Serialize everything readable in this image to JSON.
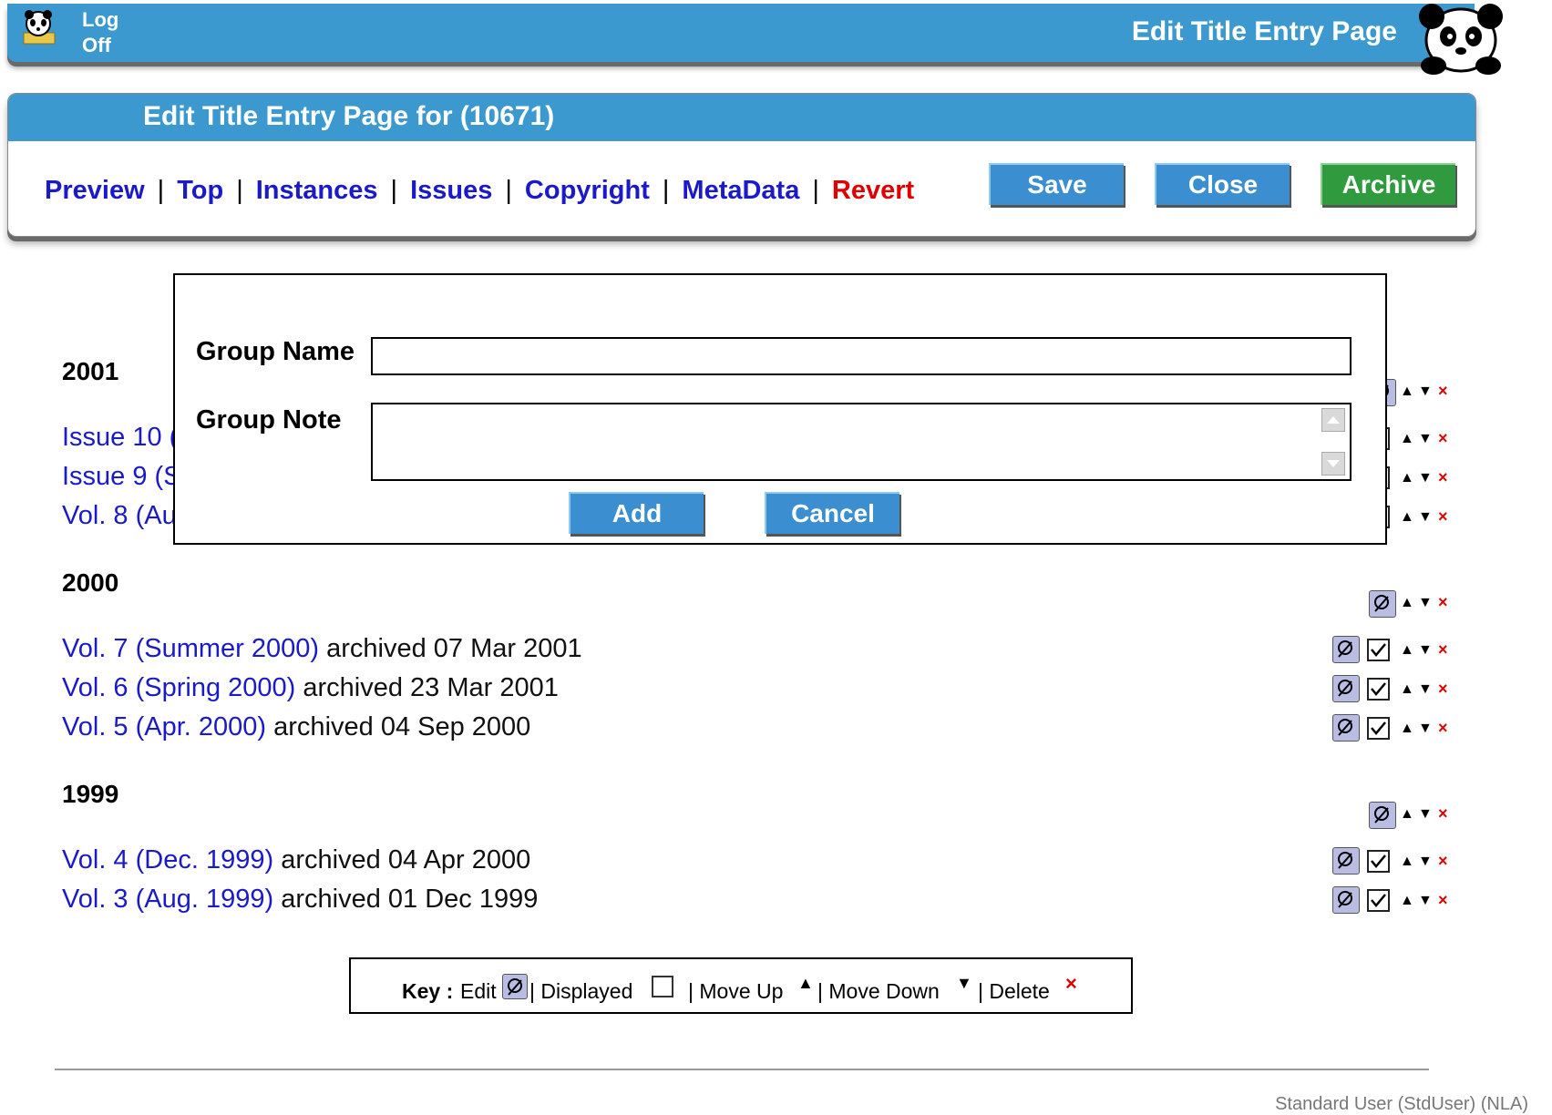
{
  "header": {
    "logoff_label_line1": "Log",
    "logoff_label_line2": "Off",
    "page_title": "Edit Title Entry Page"
  },
  "panel": {
    "title": "Edit Title Entry Page for (10671)",
    "nav": [
      "Preview",
      "Top",
      "Instances",
      "Issues",
      "Copyright",
      "MetaData",
      "Revert"
    ],
    "buttons": {
      "save": "Save",
      "close": "Close",
      "archive": "Archive"
    }
  },
  "groups": [
    {
      "year": "2001",
      "items": [
        {
          "link": "Issue 10 (",
          "rest": ""
        },
        {
          "link": "Issue 9 (S",
          "rest": ""
        },
        {
          "link": "Vol. 8 (Au",
          "rest": ""
        }
      ]
    },
    {
      "year": "2000",
      "items": [
        {
          "link": "Vol. 7 (Summer 2000)",
          "rest": " archived 07 Mar 2001"
        },
        {
          "link": "Vol. 6 (Spring 2000)",
          "rest": " archived 23 Mar 2001"
        },
        {
          "link": "Vol. 5 (Apr. 2000)",
          "rest": " archived 04 Sep 2000"
        }
      ]
    },
    {
      "year": "1999",
      "items": [
        {
          "link": "Vol. 4 (Dec. 1999)",
          "rest": " archived 04 Apr 2000"
        },
        {
          "link": "Vol. 3 (Aug. 1999)",
          "rest": " archived 01 Dec 1999"
        }
      ]
    }
  ],
  "modal": {
    "group_name_label": "Group Name",
    "group_name_value": "",
    "group_note_label": "Group Note",
    "group_note_value": "",
    "add_label": "Add",
    "cancel_label": "Cancel"
  },
  "key": {
    "key_label": "Key :",
    "edit": "Edit",
    "displayed": "| Displayed",
    "move_up": "| Move Up",
    "move_down": "| Move Down",
    "delete": "| Delete"
  },
  "footer": {
    "user": "Standard User (StdUser) (NLA)"
  },
  "colors": {
    "banner": "#3b99cf",
    "link": "#1a1ac8",
    "revert": "#e00000",
    "archive": "#2f9a3e",
    "save_close": "#3b8fd0"
  }
}
